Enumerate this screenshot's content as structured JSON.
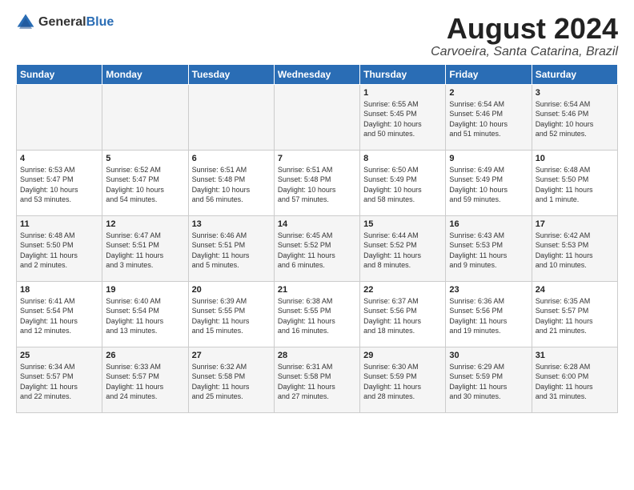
{
  "logo": {
    "general": "General",
    "blue": "Blue"
  },
  "header": {
    "title": "August 2024",
    "subtitle": "Carvoeira, Santa Catarina, Brazil"
  },
  "weekdays": [
    "Sunday",
    "Monday",
    "Tuesday",
    "Wednesday",
    "Thursday",
    "Friday",
    "Saturday"
  ],
  "weeks": [
    [
      {
        "day": "",
        "info": ""
      },
      {
        "day": "",
        "info": ""
      },
      {
        "day": "",
        "info": ""
      },
      {
        "day": "",
        "info": ""
      },
      {
        "day": "1",
        "info": "Sunrise: 6:55 AM\nSunset: 5:45 PM\nDaylight: 10 hours\nand 50 minutes."
      },
      {
        "day": "2",
        "info": "Sunrise: 6:54 AM\nSunset: 5:46 PM\nDaylight: 10 hours\nand 51 minutes."
      },
      {
        "day": "3",
        "info": "Sunrise: 6:54 AM\nSunset: 5:46 PM\nDaylight: 10 hours\nand 52 minutes."
      }
    ],
    [
      {
        "day": "4",
        "info": "Sunrise: 6:53 AM\nSunset: 5:47 PM\nDaylight: 10 hours\nand 53 minutes."
      },
      {
        "day": "5",
        "info": "Sunrise: 6:52 AM\nSunset: 5:47 PM\nDaylight: 10 hours\nand 54 minutes."
      },
      {
        "day": "6",
        "info": "Sunrise: 6:51 AM\nSunset: 5:48 PM\nDaylight: 10 hours\nand 56 minutes."
      },
      {
        "day": "7",
        "info": "Sunrise: 6:51 AM\nSunset: 5:48 PM\nDaylight: 10 hours\nand 57 minutes."
      },
      {
        "day": "8",
        "info": "Sunrise: 6:50 AM\nSunset: 5:49 PM\nDaylight: 10 hours\nand 58 minutes."
      },
      {
        "day": "9",
        "info": "Sunrise: 6:49 AM\nSunset: 5:49 PM\nDaylight: 10 hours\nand 59 minutes."
      },
      {
        "day": "10",
        "info": "Sunrise: 6:48 AM\nSunset: 5:50 PM\nDaylight: 11 hours\nand 1 minute."
      }
    ],
    [
      {
        "day": "11",
        "info": "Sunrise: 6:48 AM\nSunset: 5:50 PM\nDaylight: 11 hours\nand 2 minutes."
      },
      {
        "day": "12",
        "info": "Sunrise: 6:47 AM\nSunset: 5:51 PM\nDaylight: 11 hours\nand 3 minutes."
      },
      {
        "day": "13",
        "info": "Sunrise: 6:46 AM\nSunset: 5:51 PM\nDaylight: 11 hours\nand 5 minutes."
      },
      {
        "day": "14",
        "info": "Sunrise: 6:45 AM\nSunset: 5:52 PM\nDaylight: 11 hours\nand 6 minutes."
      },
      {
        "day": "15",
        "info": "Sunrise: 6:44 AM\nSunset: 5:52 PM\nDaylight: 11 hours\nand 8 minutes."
      },
      {
        "day": "16",
        "info": "Sunrise: 6:43 AM\nSunset: 5:53 PM\nDaylight: 11 hours\nand 9 minutes."
      },
      {
        "day": "17",
        "info": "Sunrise: 6:42 AM\nSunset: 5:53 PM\nDaylight: 11 hours\nand 10 minutes."
      }
    ],
    [
      {
        "day": "18",
        "info": "Sunrise: 6:41 AM\nSunset: 5:54 PM\nDaylight: 11 hours\nand 12 minutes."
      },
      {
        "day": "19",
        "info": "Sunrise: 6:40 AM\nSunset: 5:54 PM\nDaylight: 11 hours\nand 13 minutes."
      },
      {
        "day": "20",
        "info": "Sunrise: 6:39 AM\nSunset: 5:55 PM\nDaylight: 11 hours\nand 15 minutes."
      },
      {
        "day": "21",
        "info": "Sunrise: 6:38 AM\nSunset: 5:55 PM\nDaylight: 11 hours\nand 16 minutes."
      },
      {
        "day": "22",
        "info": "Sunrise: 6:37 AM\nSunset: 5:56 PM\nDaylight: 11 hours\nand 18 minutes."
      },
      {
        "day": "23",
        "info": "Sunrise: 6:36 AM\nSunset: 5:56 PM\nDaylight: 11 hours\nand 19 minutes."
      },
      {
        "day": "24",
        "info": "Sunrise: 6:35 AM\nSunset: 5:57 PM\nDaylight: 11 hours\nand 21 minutes."
      }
    ],
    [
      {
        "day": "25",
        "info": "Sunrise: 6:34 AM\nSunset: 5:57 PM\nDaylight: 11 hours\nand 22 minutes."
      },
      {
        "day": "26",
        "info": "Sunrise: 6:33 AM\nSunset: 5:57 PM\nDaylight: 11 hours\nand 24 minutes."
      },
      {
        "day": "27",
        "info": "Sunrise: 6:32 AM\nSunset: 5:58 PM\nDaylight: 11 hours\nand 25 minutes."
      },
      {
        "day": "28",
        "info": "Sunrise: 6:31 AM\nSunset: 5:58 PM\nDaylight: 11 hours\nand 27 minutes."
      },
      {
        "day": "29",
        "info": "Sunrise: 6:30 AM\nSunset: 5:59 PM\nDaylight: 11 hours\nand 28 minutes."
      },
      {
        "day": "30",
        "info": "Sunrise: 6:29 AM\nSunset: 5:59 PM\nDaylight: 11 hours\nand 30 minutes."
      },
      {
        "day": "31",
        "info": "Sunrise: 6:28 AM\nSunset: 6:00 PM\nDaylight: 11 hours\nand 31 minutes."
      }
    ]
  ]
}
